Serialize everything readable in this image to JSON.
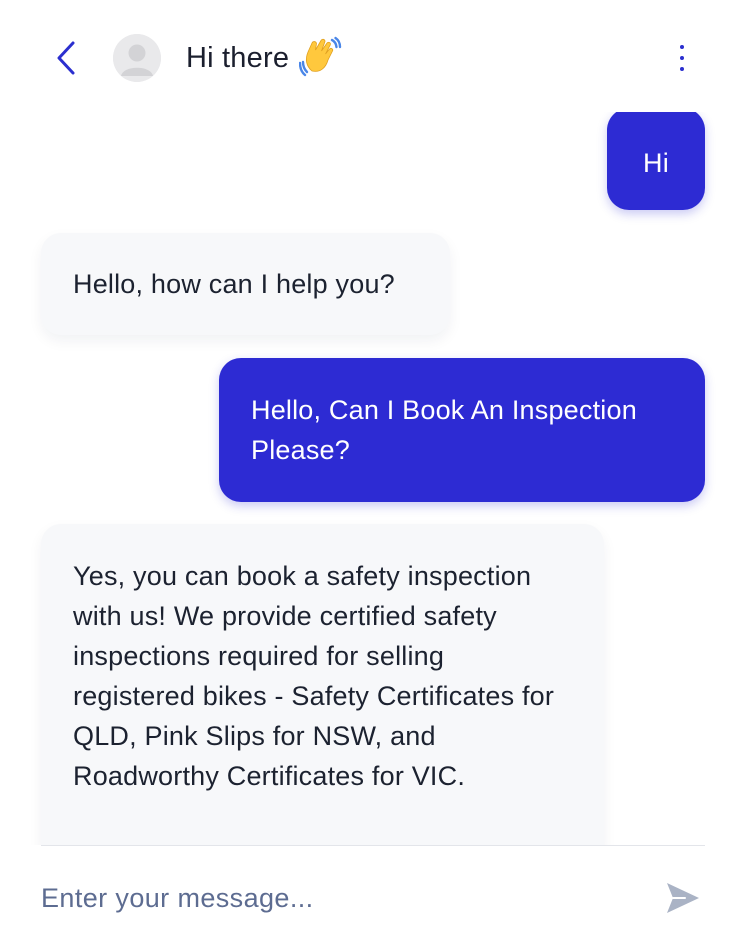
{
  "header": {
    "title": "Hi there",
    "back_icon": "chevron-left-icon",
    "avatar_icon": "user-placeholder-icon",
    "title_icon": "waving-hand-icon",
    "menu_icon": "more-vertical-icon"
  },
  "messages": [
    {
      "sender": "user",
      "text": "Hi"
    },
    {
      "sender": "bot",
      "text": "Hello, how can I help you?"
    },
    {
      "sender": "user",
      "text": "Hello, Can I Book An Inspection Please?"
    },
    {
      "sender": "bot",
      "text": "Yes, you can book a safety inspection with us! We provide certified safety inspections required for selling registered bikes - Safety Certificates for QLD, Pink Slips for NSW, and Roadworthy Certificates for VIC."
    }
  ],
  "composer": {
    "placeholder": "Enter your message...",
    "value": "",
    "send_icon": "send-icon"
  },
  "colors": {
    "accent": "#2d2bd3",
    "bot_bubble": "#f7f8fa",
    "text": "#1c2230",
    "placeholder": "#5d6c91",
    "send_icon": "#aab3c5"
  }
}
